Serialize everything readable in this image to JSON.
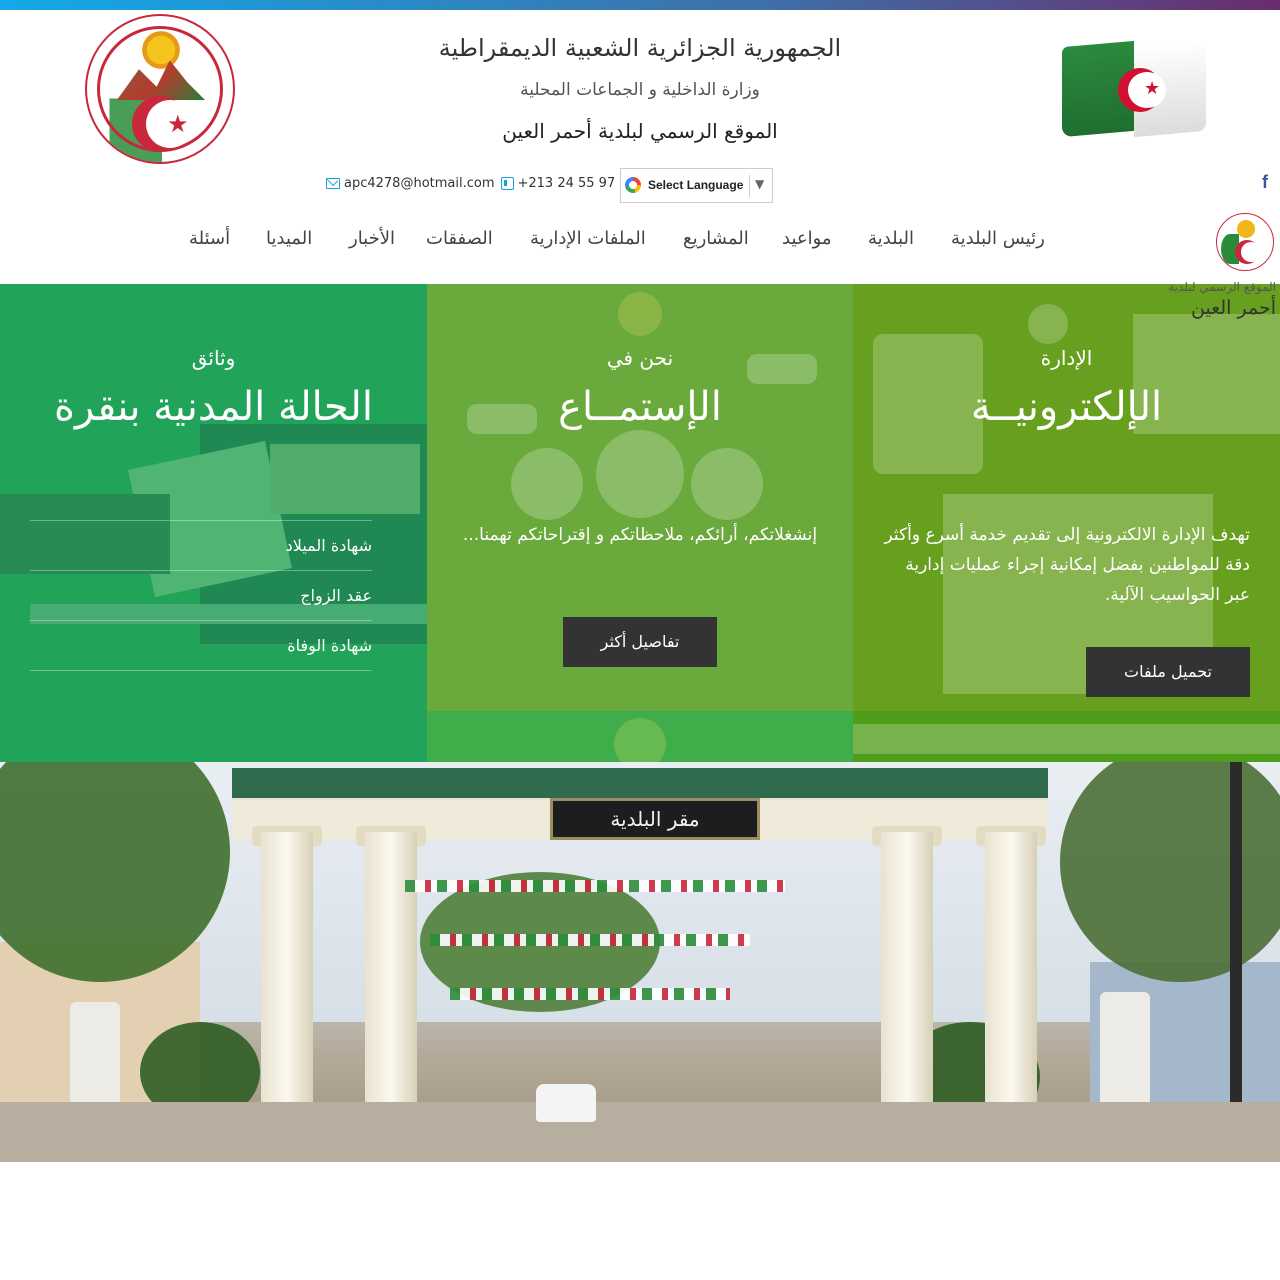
{
  "header": {
    "title_republic": "الجمهورية الجزائرية الشعبية الديمقراطية",
    "ministry": "وزارة الداخلية و الجماعات المحلية",
    "site_title": "الموقع الرسمي لبلدية أحمر العين",
    "email": "apc4278@hotmail.com",
    "phone": "+213 24 55 97 40",
    "language_select": "Select Language",
    "facebook": "f"
  },
  "nav": {
    "items": [
      "رئيس البلدية",
      "البلدية",
      "مواعيد",
      "المشاريع",
      "الملفات الإدارية",
      "الصفقات",
      "الأخبار",
      "الميديا",
      "أسئلة"
    ],
    "logo_caption_small": "الموقع الرسمي لبلدية",
    "logo_caption_big": "أحمر العين"
  },
  "panels": {
    "documents": {
      "kicker": "وثائق",
      "title": "الحالة المدنية بنقرة",
      "links": [
        "شهادة الميلاد",
        "عقد الزواج",
        "شهادة الوفاة"
      ]
    },
    "listening": {
      "kicker": "نحن في",
      "title": "الإستمــاع",
      "body": "إنشغلاتكم، أرائكم، ملاحظاتكم و إقتراحاتكم تهمنا...",
      "button": "تفاصيل أكثر"
    },
    "egov": {
      "kicker": "الإدارة",
      "title": "الإلكترونيــة",
      "body": "تهدف الإدارة الالكترونية إلى تقديم خدمة أسرع وأكثر دقة للمواطنين بفضل إمكانية إجراء عمليات إدارية عبر الحواسيب الآلية.",
      "button": "تحميل ملفات"
    }
  },
  "photo": {
    "sign": "مقر البلدية"
  },
  "colors": {
    "topbar_start": "#13a9e8",
    "topbar_end": "#6b2c6d",
    "panel_documents": "#22a35a",
    "panel_listening": "#3fae4a",
    "panel_egov": "#4f9e1b",
    "button": "#333333"
  }
}
